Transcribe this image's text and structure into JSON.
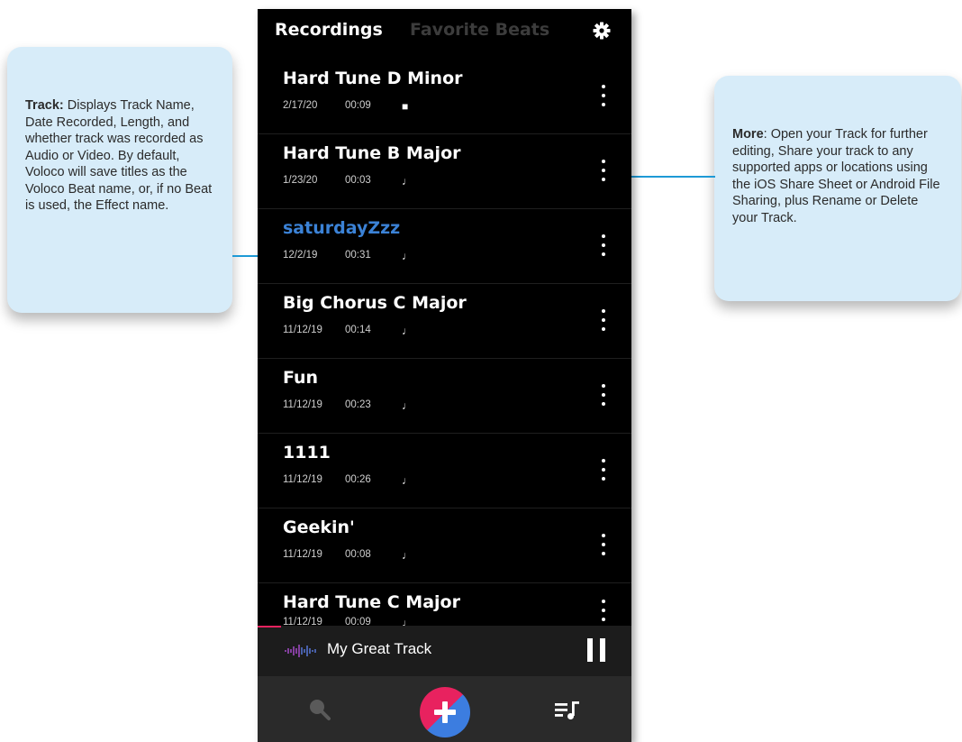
{
  "callouts": {
    "track": {
      "heading": "Track:",
      "body": " Displays Track Name, Date Recorded, Length, and whether track was recorded as Audio or Video. By default, Voloco will save titles as the Voloco Beat name, or, if no Beat is used, the Effect name."
    },
    "more": {
      "heading": "More",
      "body": ": Open your Track for further editing, Share your track to any supported apps or locations using the iOS Share Sheet or Android File Sharing, plus Rename or Delete your Track."
    }
  },
  "tabs": {
    "recordings": "Recordings",
    "favorite_beats": "Favorite Beats"
  },
  "recordings": [
    {
      "title": "Hard Tune D Minor",
      "date": "2/17/20",
      "duration": "00:09",
      "media": "video-icon",
      "glyph": "■"
    },
    {
      "title": "Hard Tune B Major",
      "date": "1/23/20",
      "duration": "00:03",
      "media": "music-note-icon",
      "glyph": "♩"
    },
    {
      "title": "saturdayZzz",
      "date": "12/2/19",
      "duration": "00:31",
      "media": "music-note-icon",
      "glyph": "♩",
      "active": true
    },
    {
      "title": "Big Chorus C Major",
      "date": "11/12/19",
      "duration": "00:14",
      "media": "music-note-icon",
      "glyph": "♩"
    },
    {
      "title": "Fun",
      "date": "11/12/19",
      "duration": "00:23",
      "media": "music-note-icon",
      "glyph": "♩"
    },
    {
      "title": "1111",
      "date": "11/12/19",
      "duration": "00:26",
      "media": "music-note-icon",
      "glyph": "♩"
    },
    {
      "title": "Geekin'",
      "date": "11/12/19",
      "duration": "00:08",
      "media": "music-note-icon",
      "glyph": "♩"
    },
    {
      "title": "Hard Tune C Major",
      "date": "11/12/19",
      "duration": "00:09",
      "media": "music-note-icon",
      "glyph": "♩"
    }
  ],
  "player": {
    "track_name": "My Great Track",
    "state": "playing"
  },
  "colors": {
    "accent_blue": "#3b82d6",
    "accent_pink": "#e8225f",
    "callout_bg": "#d7ecf9",
    "leader_line": "#1e9ad6"
  },
  "icons": {
    "settings": "gear-icon",
    "search": "search-icon",
    "add": "plus-icon",
    "queue": "playlist-icon",
    "more": "kebab-menu-icon",
    "pause": "pause-icon",
    "waveform": "waveform-icon"
  }
}
